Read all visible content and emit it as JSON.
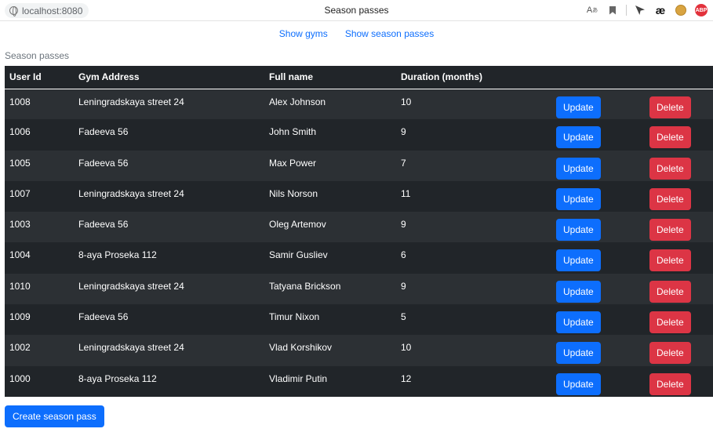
{
  "browser": {
    "url": "localhost:8080",
    "tab_title": "Season passes",
    "extensions": [
      "translate-icon",
      "bookmark-icon",
      "pointer-icon",
      "ae-icon",
      "cookie-icon",
      "abp-icon"
    ],
    "ae_label": "æ",
    "abp_label": "ABP"
  },
  "nav": {
    "show_gyms": "Show gyms",
    "show_season_passes": "Show season passes"
  },
  "section_label": "Season passes",
  "table": {
    "headers": [
      "User Id",
      "Gym Address",
      "Full name",
      "Duration (months)"
    ],
    "rows": [
      {
        "user_id": "1008",
        "gym_address": "Leningradskaya street 24",
        "full_name": "Alex Johnson",
        "duration": "10"
      },
      {
        "user_id": "1006",
        "gym_address": "Fadeeva 56",
        "full_name": "John Smith",
        "duration": "9"
      },
      {
        "user_id": "1005",
        "gym_address": "Fadeeva 56",
        "full_name": "Max Power",
        "duration": "7"
      },
      {
        "user_id": "1007",
        "gym_address": "Leningradskaya street 24",
        "full_name": "Nils Norson",
        "duration": "11"
      },
      {
        "user_id": "1003",
        "gym_address": "Fadeeva 56",
        "full_name": "Oleg Artemov",
        "duration": "9"
      },
      {
        "user_id": "1004",
        "gym_address": "8-aya Proseka 112",
        "full_name": "Samir Gusliev",
        "duration": "6"
      },
      {
        "user_id": "1010",
        "gym_address": "Leningradskaya street 24",
        "full_name": "Tatyana Brickson",
        "duration": "9"
      },
      {
        "user_id": "1009",
        "gym_address": "Fadeeva 56",
        "full_name": "Timur Nixon",
        "duration": "5"
      },
      {
        "user_id": "1002",
        "gym_address": "Leningradskaya street 24",
        "full_name": "Vlad Korshikov",
        "duration": "10"
      },
      {
        "user_id": "1000",
        "gym_address": "8-aya Proseka 112",
        "full_name": "Vladimir Putin",
        "duration": "12"
      }
    ],
    "update_label": "Update",
    "delete_label": "Delete"
  },
  "create_button": "Create season pass",
  "colors": {
    "primary": "#0d6efd",
    "danger": "#dc3545",
    "table_dark": "#212529",
    "table_striped": "#2c3034"
  }
}
